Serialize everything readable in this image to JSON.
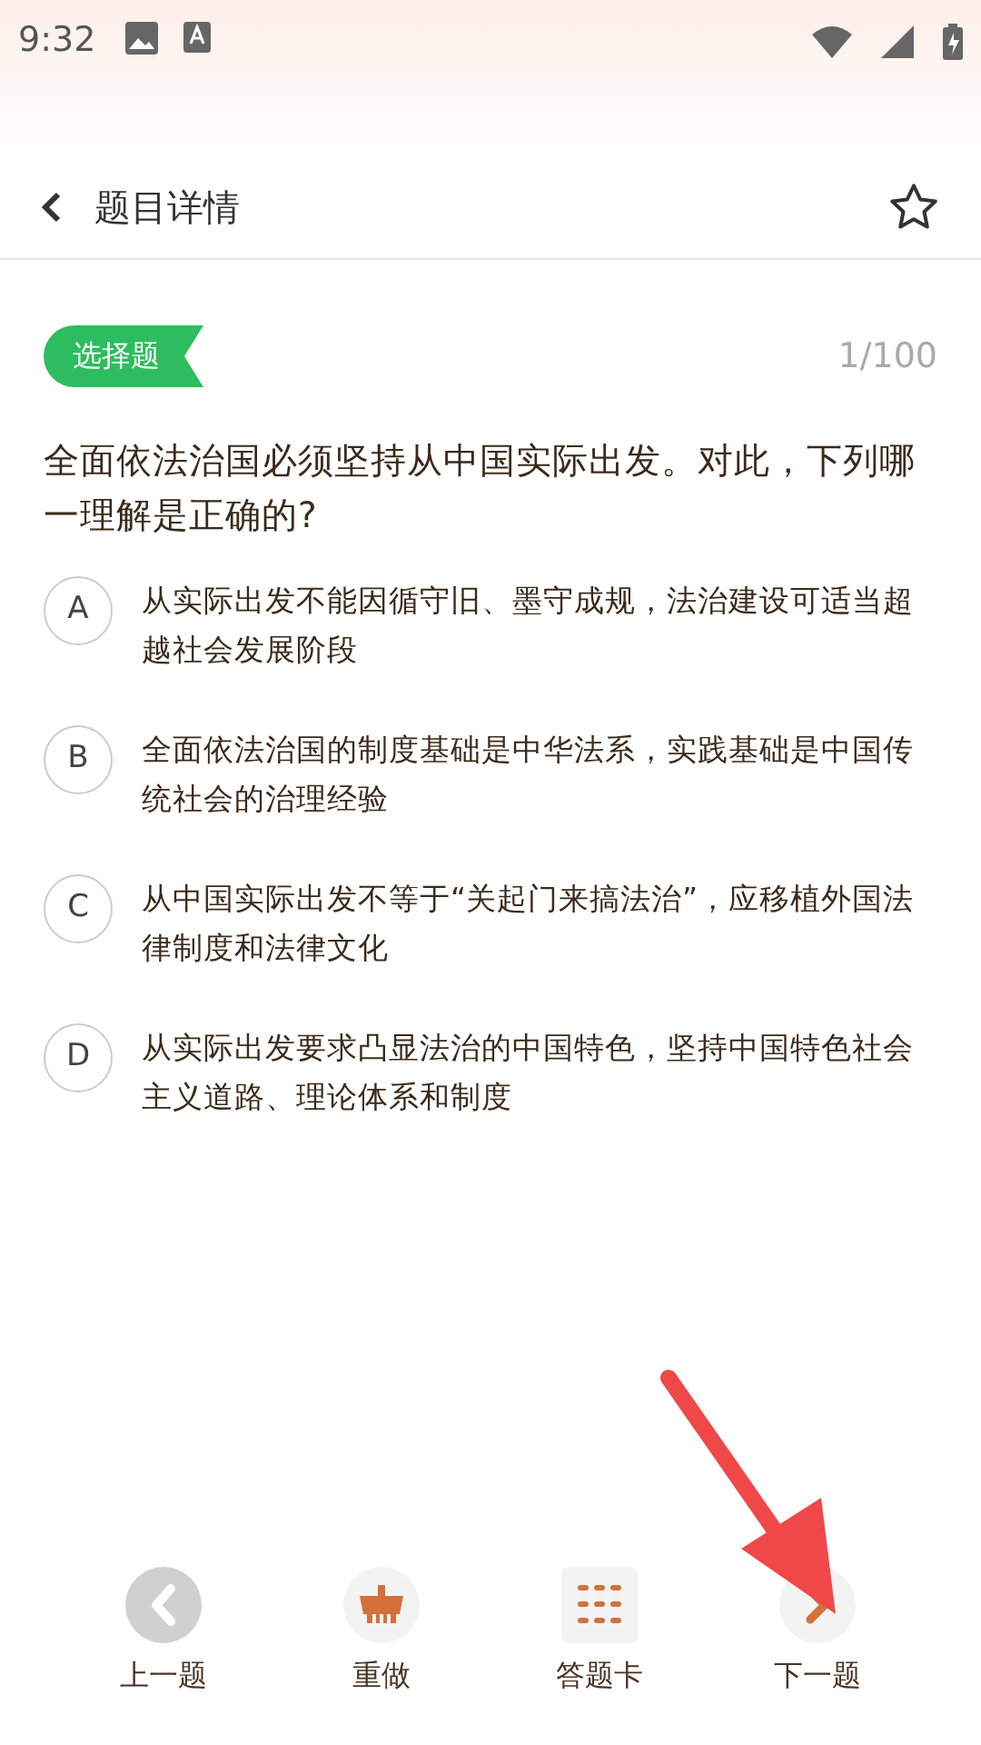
{
  "status_bar": {
    "time": "9:32"
  },
  "header": {
    "title": "题目详情",
    "favorited": false
  },
  "question": {
    "type_tag": "选择题",
    "progress": "1/100",
    "text": "全面依法治国必须坚持从中国实际出发。对此，下列哪一理解是正确的?"
  },
  "options": [
    {
      "letter": "A",
      "text": "从实际出发不能因循守旧、墨守成规，法治建设可适当超越社会发展阶段",
      "selected": false
    },
    {
      "letter": "B",
      "text": "全面依法治国的制度基础是中华法系，实践基础是中国传统社会的治理经验",
      "selected": false
    },
    {
      "letter": "C",
      "text": "从中国实际出发不等于“关起门来搞法治”，应移植外国法律制度和法律文化",
      "selected": false
    },
    {
      "letter": "D",
      "text": "从实际出发要求凸显法治的中国特色，坚持中国特色社会主义道路、理论体系和制度",
      "selected": false
    }
  ],
  "bottom_bar": [
    {
      "kind": "prev",
      "label": "上一题",
      "disabled": true
    },
    {
      "kind": "redo",
      "label": "重做",
      "disabled": false
    },
    {
      "kind": "card",
      "label": "答题卡",
      "disabled": false
    },
    {
      "kind": "next",
      "label": "下一题",
      "disabled": false
    }
  ]
}
